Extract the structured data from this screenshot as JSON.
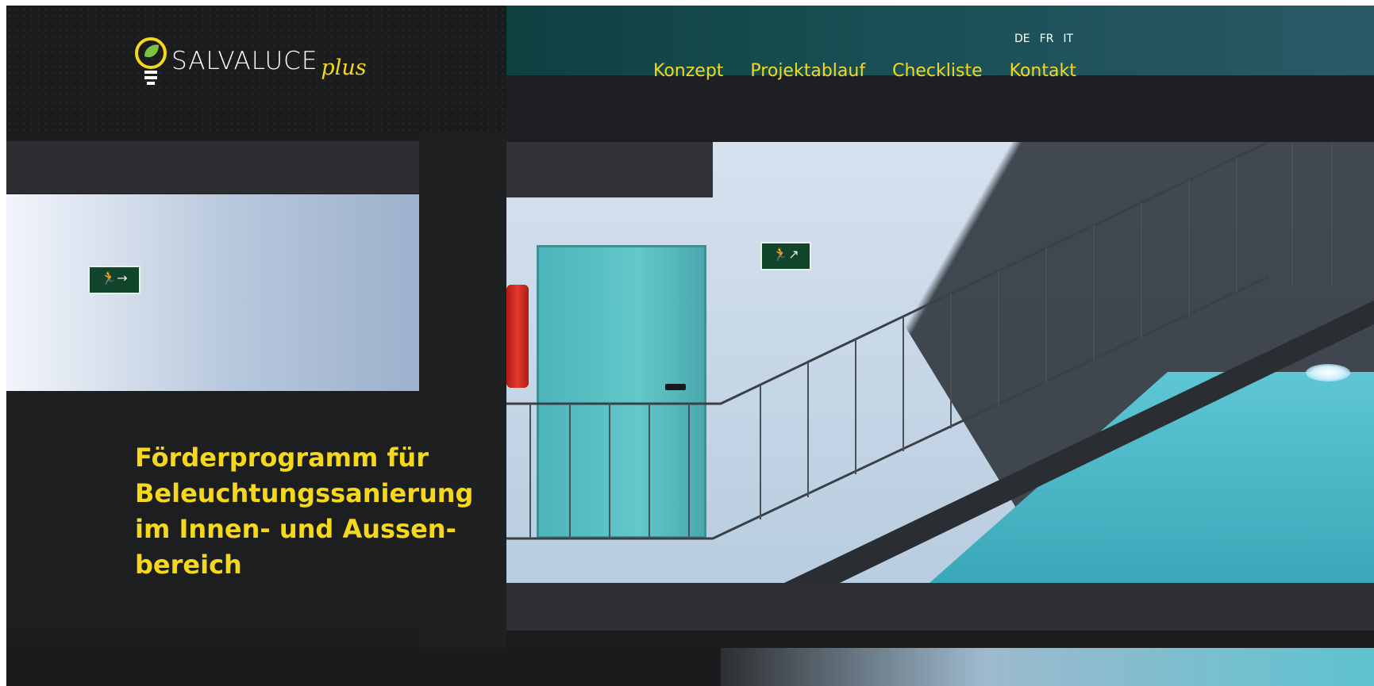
{
  "brand": {
    "name": "SALVALUCE",
    "suffix": "plus",
    "accent_color": "#f5d81c"
  },
  "languages": [
    "DE",
    "FR",
    "IT"
  ],
  "nav": {
    "items": [
      "Konzept",
      "Projektablauf",
      "Checkliste",
      "Kontakt"
    ]
  },
  "hero": {
    "lines": [
      "Förderprogramm für",
      "Beleuchtungssanierung",
      "im Innen- und Aussen-",
      "bereich"
    ]
  },
  "icons": {
    "logo": "lightbulb-leaf-icon",
    "exit_sign": "emergency-exit-icon"
  }
}
